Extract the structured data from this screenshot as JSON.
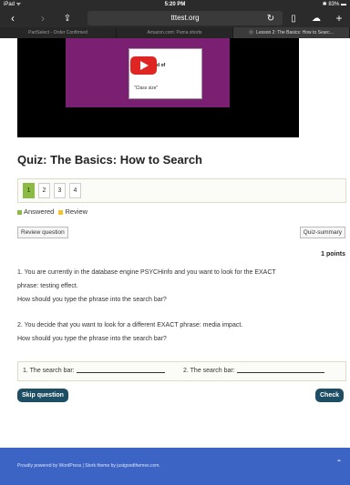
{
  "status_bar": {
    "carrier": "iPad ᯤ",
    "time": "5:20 PM",
    "battery": "✱ 83% ▬"
  },
  "toolbar": {
    "url": "tttest.org"
  },
  "browser_tabs": [
    {
      "label": "PartSelect - Order Confirmed"
    },
    {
      "label": "Amazon.com: Puma shorts"
    },
    {
      "label": "Lesson 2: The Basics: How to Searc..."
    }
  ],
  "video": {
    "text_1": "Use instead of",
    "text_2": "\"Class size\""
  },
  "quiz": {
    "title": "Quiz: The Basics: How to Search",
    "pages": [
      "1",
      "2",
      "3",
      "4"
    ],
    "legend": {
      "answered": "Answered",
      "review": "Review"
    },
    "review_button": "Review question",
    "summary_button": "Quiz-summary",
    "points": "1 points",
    "question_1": [
      "1. You are currently in the database engine PSYCHinfo and you want to look for the EXACT",
      "phrase: testing effect.",
      "How should you type the phrase into the search bar?"
    ],
    "question_2": [
      "2. You decide that you want to look for a different EXACT phrase: media impact.",
      "How should you type the phrase into the search bar?"
    ],
    "answer_1_label": "1. The search bar:",
    "answer_2_label": "2. The search bar:",
    "skip_button": "Skip question",
    "check_button": "Check"
  },
  "footer": {
    "text": "Proudly powered by WordPress | Stork theme by justgoodthemes.com."
  },
  "colors": {
    "accent_green": "#8bba45",
    "review_yellow": "#f6c12c",
    "button_dark": "#1d4e63",
    "footer_blue": "#3b64c4"
  }
}
